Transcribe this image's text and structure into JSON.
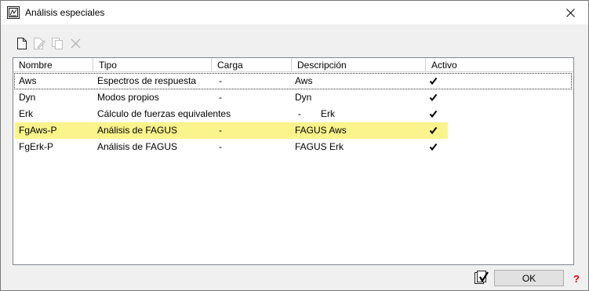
{
  "window": {
    "title": "Análisis especiales",
    "close_glyph": "✕"
  },
  "toolbar": {
    "buttons": [
      {
        "icon": "new-document-icon",
        "enabled": true
      },
      {
        "icon": "edit-document-icon",
        "enabled": false
      },
      {
        "icon": "copy-icon",
        "enabled": false
      },
      {
        "icon": "delete-icon",
        "enabled": false
      }
    ]
  },
  "grid": {
    "columns": [
      "Nombre",
      "Tipo",
      "Carga",
      "Descripción",
      "Activo"
    ],
    "rows": [
      {
        "nombre": "Aws",
        "tipo": "Espectros de respuesta",
        "carga": "-",
        "descripcion": "Aws",
        "activo": true,
        "focused": true,
        "highlighted": false
      },
      {
        "nombre": "Dyn",
        "tipo": "Modos propios",
        "carga": "-",
        "descripcion": "Dyn",
        "activo": true,
        "focused": false,
        "highlighted": false
      },
      {
        "nombre": "Erk",
        "tipo": "Cálculo de fuerzas equivalentes",
        "carga": "-",
        "descripcion": "Erk",
        "activo": true,
        "focused": false,
        "highlighted": false
      },
      {
        "nombre": "FgAws-P",
        "tipo": "Análisis de FAGUS",
        "carga": "-",
        "descripcion": "FAGUS Aws",
        "activo": true,
        "focused": false,
        "highlighted": true
      },
      {
        "nombre": "FgErk-P",
        "tipo": "Análisis de FAGUS",
        "carga": "-",
        "descripcion": "FAGUS Erk",
        "activo": true,
        "focused": false,
        "highlighted": false
      }
    ]
  },
  "footer": {
    "ok_label": "OK",
    "help_label": "?"
  },
  "colors": {
    "highlight": "#fbf48c",
    "help": "#e00000"
  }
}
